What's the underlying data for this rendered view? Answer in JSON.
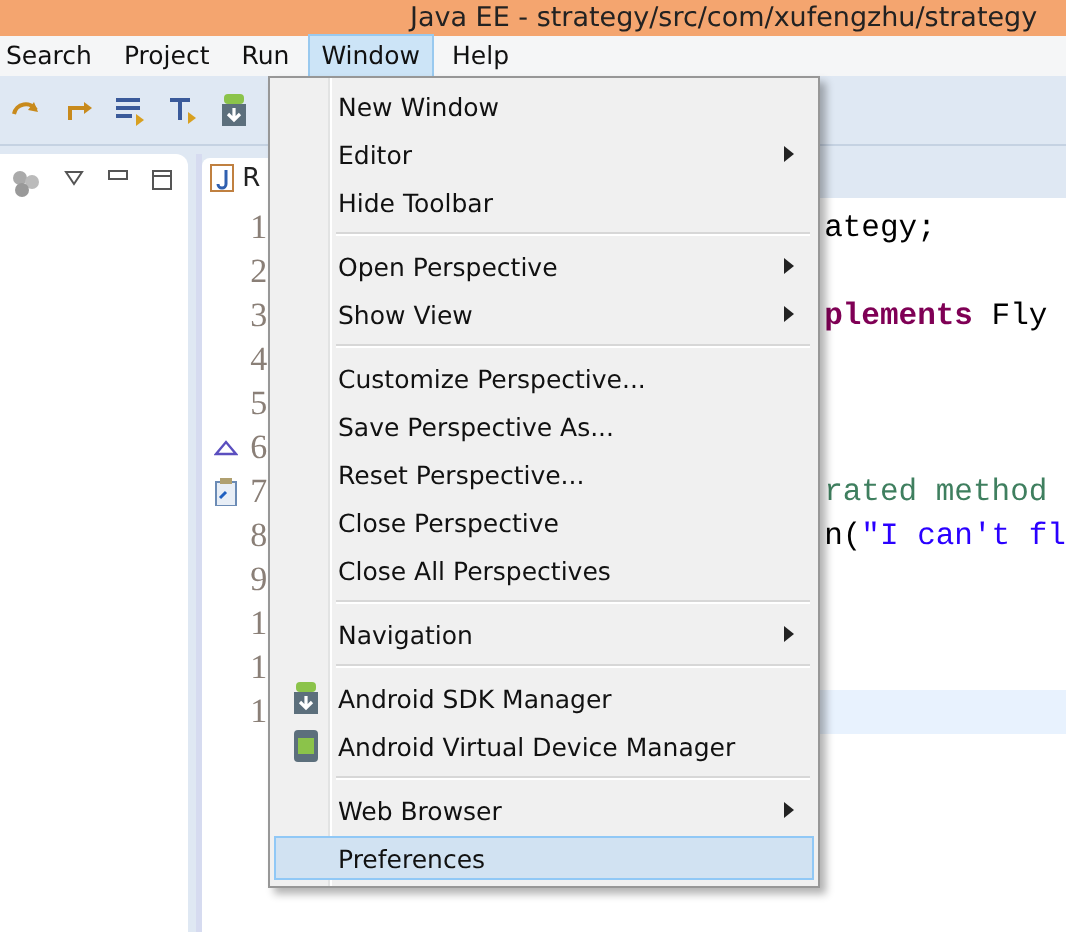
{
  "window": {
    "title": "Java EE - strategy/src/com/xufengzhu/strategy"
  },
  "menu_bar": [
    {
      "label": "Search",
      "selected": false
    },
    {
      "label": "Project",
      "selected": false
    },
    {
      "label": "Run",
      "selected": false
    },
    {
      "label": "Window",
      "selected": true
    },
    {
      "label": "Help",
      "selected": false
    }
  ],
  "editor": {
    "tab": {
      "label": "R"
    },
    "lines": [
      {
        "number": "1",
        "kind": "plain",
        "segments": [
          {
            "text": "ategy;",
            "kind": "plain"
          }
        ]
      },
      {
        "number": "2",
        "kind": "plain"
      },
      {
        "number": "3",
        "kind": "plain",
        "segments": [
          {
            "text": "plements",
            "kind": "keyword"
          },
          {
            "text": " Fly",
            "kind": "plain"
          }
        ]
      },
      {
        "number": "4",
        "kind": "plain"
      },
      {
        "number": "5",
        "kind": "plain"
      },
      {
        "number": "6",
        "kind": "override"
      },
      {
        "number": "7",
        "kind": "task",
        "segments": [
          {
            "text": "rated method",
            "kind": "comment"
          }
        ]
      },
      {
        "number": "8",
        "kind": "plain",
        "segments": [
          {
            "text": "n(",
            "kind": "plain"
          },
          {
            "text": "\"I can't fl",
            "kind": "string"
          }
        ]
      },
      {
        "number": "9",
        "kind": "plain"
      },
      {
        "number": "1",
        "kind": "plain"
      },
      {
        "number": "1",
        "kind": "plain"
      },
      {
        "number": "1",
        "kind": "plain",
        "current": true
      }
    ]
  },
  "window_menu": [
    [
      {
        "label": "New Window",
        "submenu": false,
        "selected": false
      },
      {
        "label": "Editor",
        "submenu": true,
        "selected": false
      },
      {
        "label": "Hide Toolbar",
        "submenu": false,
        "selected": false
      }
    ],
    [
      {
        "label": "Open Perspective",
        "submenu": true,
        "selected": false
      },
      {
        "label": "Show View",
        "submenu": true,
        "selected": false
      }
    ],
    [
      {
        "label": "Customize Perspective...",
        "submenu": false,
        "selected": false
      },
      {
        "label": "Save Perspective As...",
        "submenu": false,
        "selected": false
      },
      {
        "label": "Reset Perspective...",
        "submenu": false,
        "selected": false
      },
      {
        "label": "Close Perspective",
        "submenu": false,
        "selected": false
      },
      {
        "label": "Close All Perspectives",
        "submenu": false,
        "selected": false
      }
    ],
    [
      {
        "label": "Navigation",
        "submenu": true,
        "selected": false
      }
    ],
    [
      {
        "label": "Android SDK Manager",
        "submenu": false,
        "selected": false,
        "kind": "sdk"
      },
      {
        "label": "Android Virtual Device Manager",
        "submenu": false,
        "selected": false,
        "kind": "avd"
      }
    ],
    [
      {
        "label": "Web Browser",
        "submenu": true,
        "selected": false
      },
      {
        "label": "Preferences",
        "submenu": false,
        "selected": true
      }
    ]
  ]
}
